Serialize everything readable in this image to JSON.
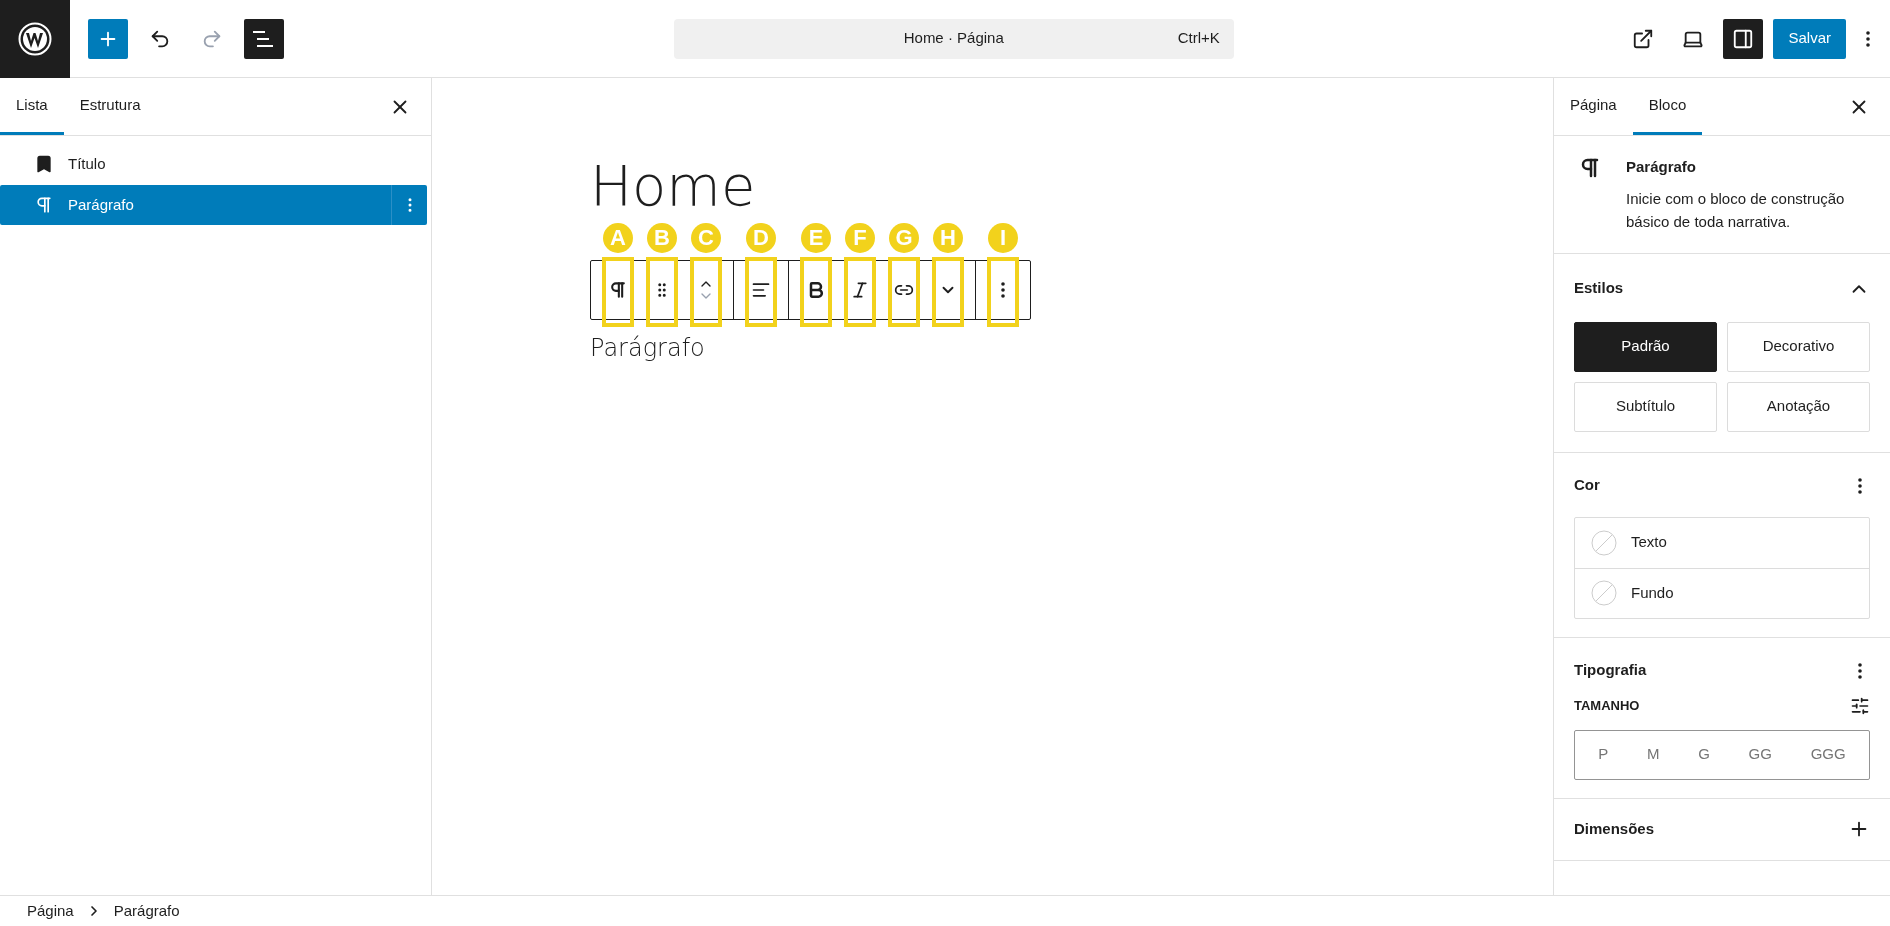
{
  "top_bar": {
    "add_block": {
      "pressed": false
    },
    "undo": {
      "disabled": false
    },
    "redo": {
      "disabled": true
    },
    "list_view": {
      "pressed": true
    },
    "command": {
      "title": "Home · Página",
      "shortcut": "Ctrl+K"
    },
    "sidebar_toggle": {
      "pressed": true
    },
    "save": "Salvar"
  },
  "left_panel": {
    "tabs": [
      {
        "label": "Lista",
        "selected": true
      },
      {
        "label": "Estrutura",
        "selected": false
      }
    ],
    "items": [
      {
        "kind": "heading",
        "label": "Título",
        "selected": false
      },
      {
        "kind": "paragraph",
        "label": "Parágrafo",
        "selected": true
      }
    ]
  },
  "canvas": {
    "title": "Home",
    "paragraph": "Parágrafo",
    "toolbar": [
      [
        {
          "kind": "paragraph",
          "callout": "A"
        },
        {
          "kind": "drag",
          "callout": "B"
        },
        {
          "kind": "mover",
          "callout": "C"
        }
      ],
      [
        {
          "kind": "align",
          "callout": "D"
        }
      ],
      [
        {
          "kind": "bold",
          "callout": "E"
        },
        {
          "kind": "italic",
          "callout": "F"
        },
        {
          "kind": "link",
          "callout": "G"
        },
        {
          "kind": "more",
          "callout": "H"
        }
      ],
      [
        {
          "kind": "options",
          "callout": "I"
        }
      ]
    ]
  },
  "right_panel": {
    "tabs": [
      {
        "label": "Página",
        "selected": false
      },
      {
        "label": "Bloco",
        "selected": true
      }
    ],
    "block": {
      "title": "Parágrafo",
      "description": "Inicie com o bloco de construção básico de toda narrativa."
    },
    "styles": {
      "title": "Estilos",
      "expanded": true,
      "options": [
        {
          "label": "Padrão",
          "selected": true
        },
        {
          "label": "Decorativo",
          "selected": false
        },
        {
          "label": "Subtítulo",
          "selected": false
        },
        {
          "label": "Anotação",
          "selected": false
        }
      ]
    },
    "color": {
      "title": "Cor",
      "items": [
        "Texto",
        "Fundo"
      ]
    },
    "typography": {
      "title": "Tipografia",
      "size_label": "TAMANHO",
      "sizes": [
        "P",
        "M",
        "G",
        "GG",
        "GGG"
      ]
    },
    "dimensions": {
      "title": "Dimensões",
      "expanded": false
    }
  },
  "breadcrumb": [
    "Página",
    "Parágrafo"
  ]
}
